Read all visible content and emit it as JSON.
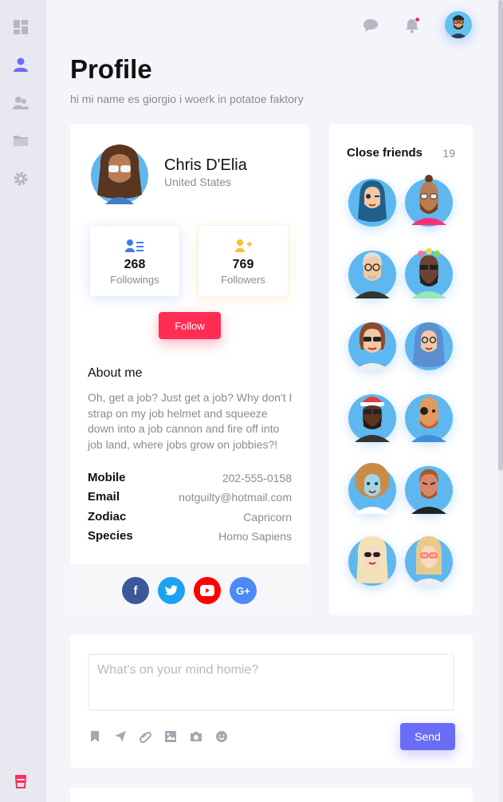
{
  "header": {
    "title": "Profile",
    "subtitle": "hi mi name es giorgio i woerk in potatoe faktory"
  },
  "sidebar": {
    "items": [
      {
        "icon": "dashboard-icon",
        "active": false
      },
      {
        "icon": "user-icon",
        "active": true
      },
      {
        "icon": "users-icon",
        "active": false
      },
      {
        "icon": "folder-icon",
        "active": false
      },
      {
        "icon": "gear-icon",
        "active": false
      }
    ],
    "bottom_icon": "coffee-cup-icon"
  },
  "topbar": {
    "icons": [
      "chat-icon",
      "bell-icon"
    ],
    "notification": true
  },
  "profile": {
    "name": "Chris D'Elia",
    "country": "United States",
    "followings_count": "268",
    "followings_label": "Followings",
    "followers_count": "769",
    "followers_label": "Followers",
    "follow_label": "Follow",
    "about_title": "About me",
    "about_text": "Oh, get a job? Just get a job? Why don't I strap on my job helmet and squeeze down into a job cannon and fire off into job land, where jobs grow on jobbies?!",
    "info": [
      {
        "key": "Mobile",
        "value": "202-555-0158"
      },
      {
        "key": "Email",
        "value": "notguilty@hotmail.com"
      },
      {
        "key": "Zodiac",
        "value": "Capricorn"
      },
      {
        "key": "Species",
        "value": "Homo Sapiens"
      }
    ],
    "social": [
      {
        "name": "facebook-icon",
        "glyph": "f",
        "color": "#3b5998"
      },
      {
        "name": "twitter-icon",
        "glyph": "t",
        "color": "#1da1f2"
      },
      {
        "name": "youtube-icon",
        "glyph": "▶",
        "color": "#ff0000"
      },
      {
        "name": "google-plus-icon",
        "glyph": "G+",
        "color": "#4c8bf5"
      }
    ]
  },
  "friends": {
    "title": "Close friends",
    "count": "19"
  },
  "post": {
    "placeholder": "What's on your mind homie?",
    "send_label": "Send",
    "tools": [
      "bookmark-icon",
      "send-plane-icon",
      "paperclip-icon",
      "image-icon",
      "camera-icon",
      "smiley-icon"
    ]
  },
  "colors": {
    "accent": "#ff2d55",
    "primary": "#6a6cf6",
    "avatar_bg": "#5eb8ef"
  }
}
